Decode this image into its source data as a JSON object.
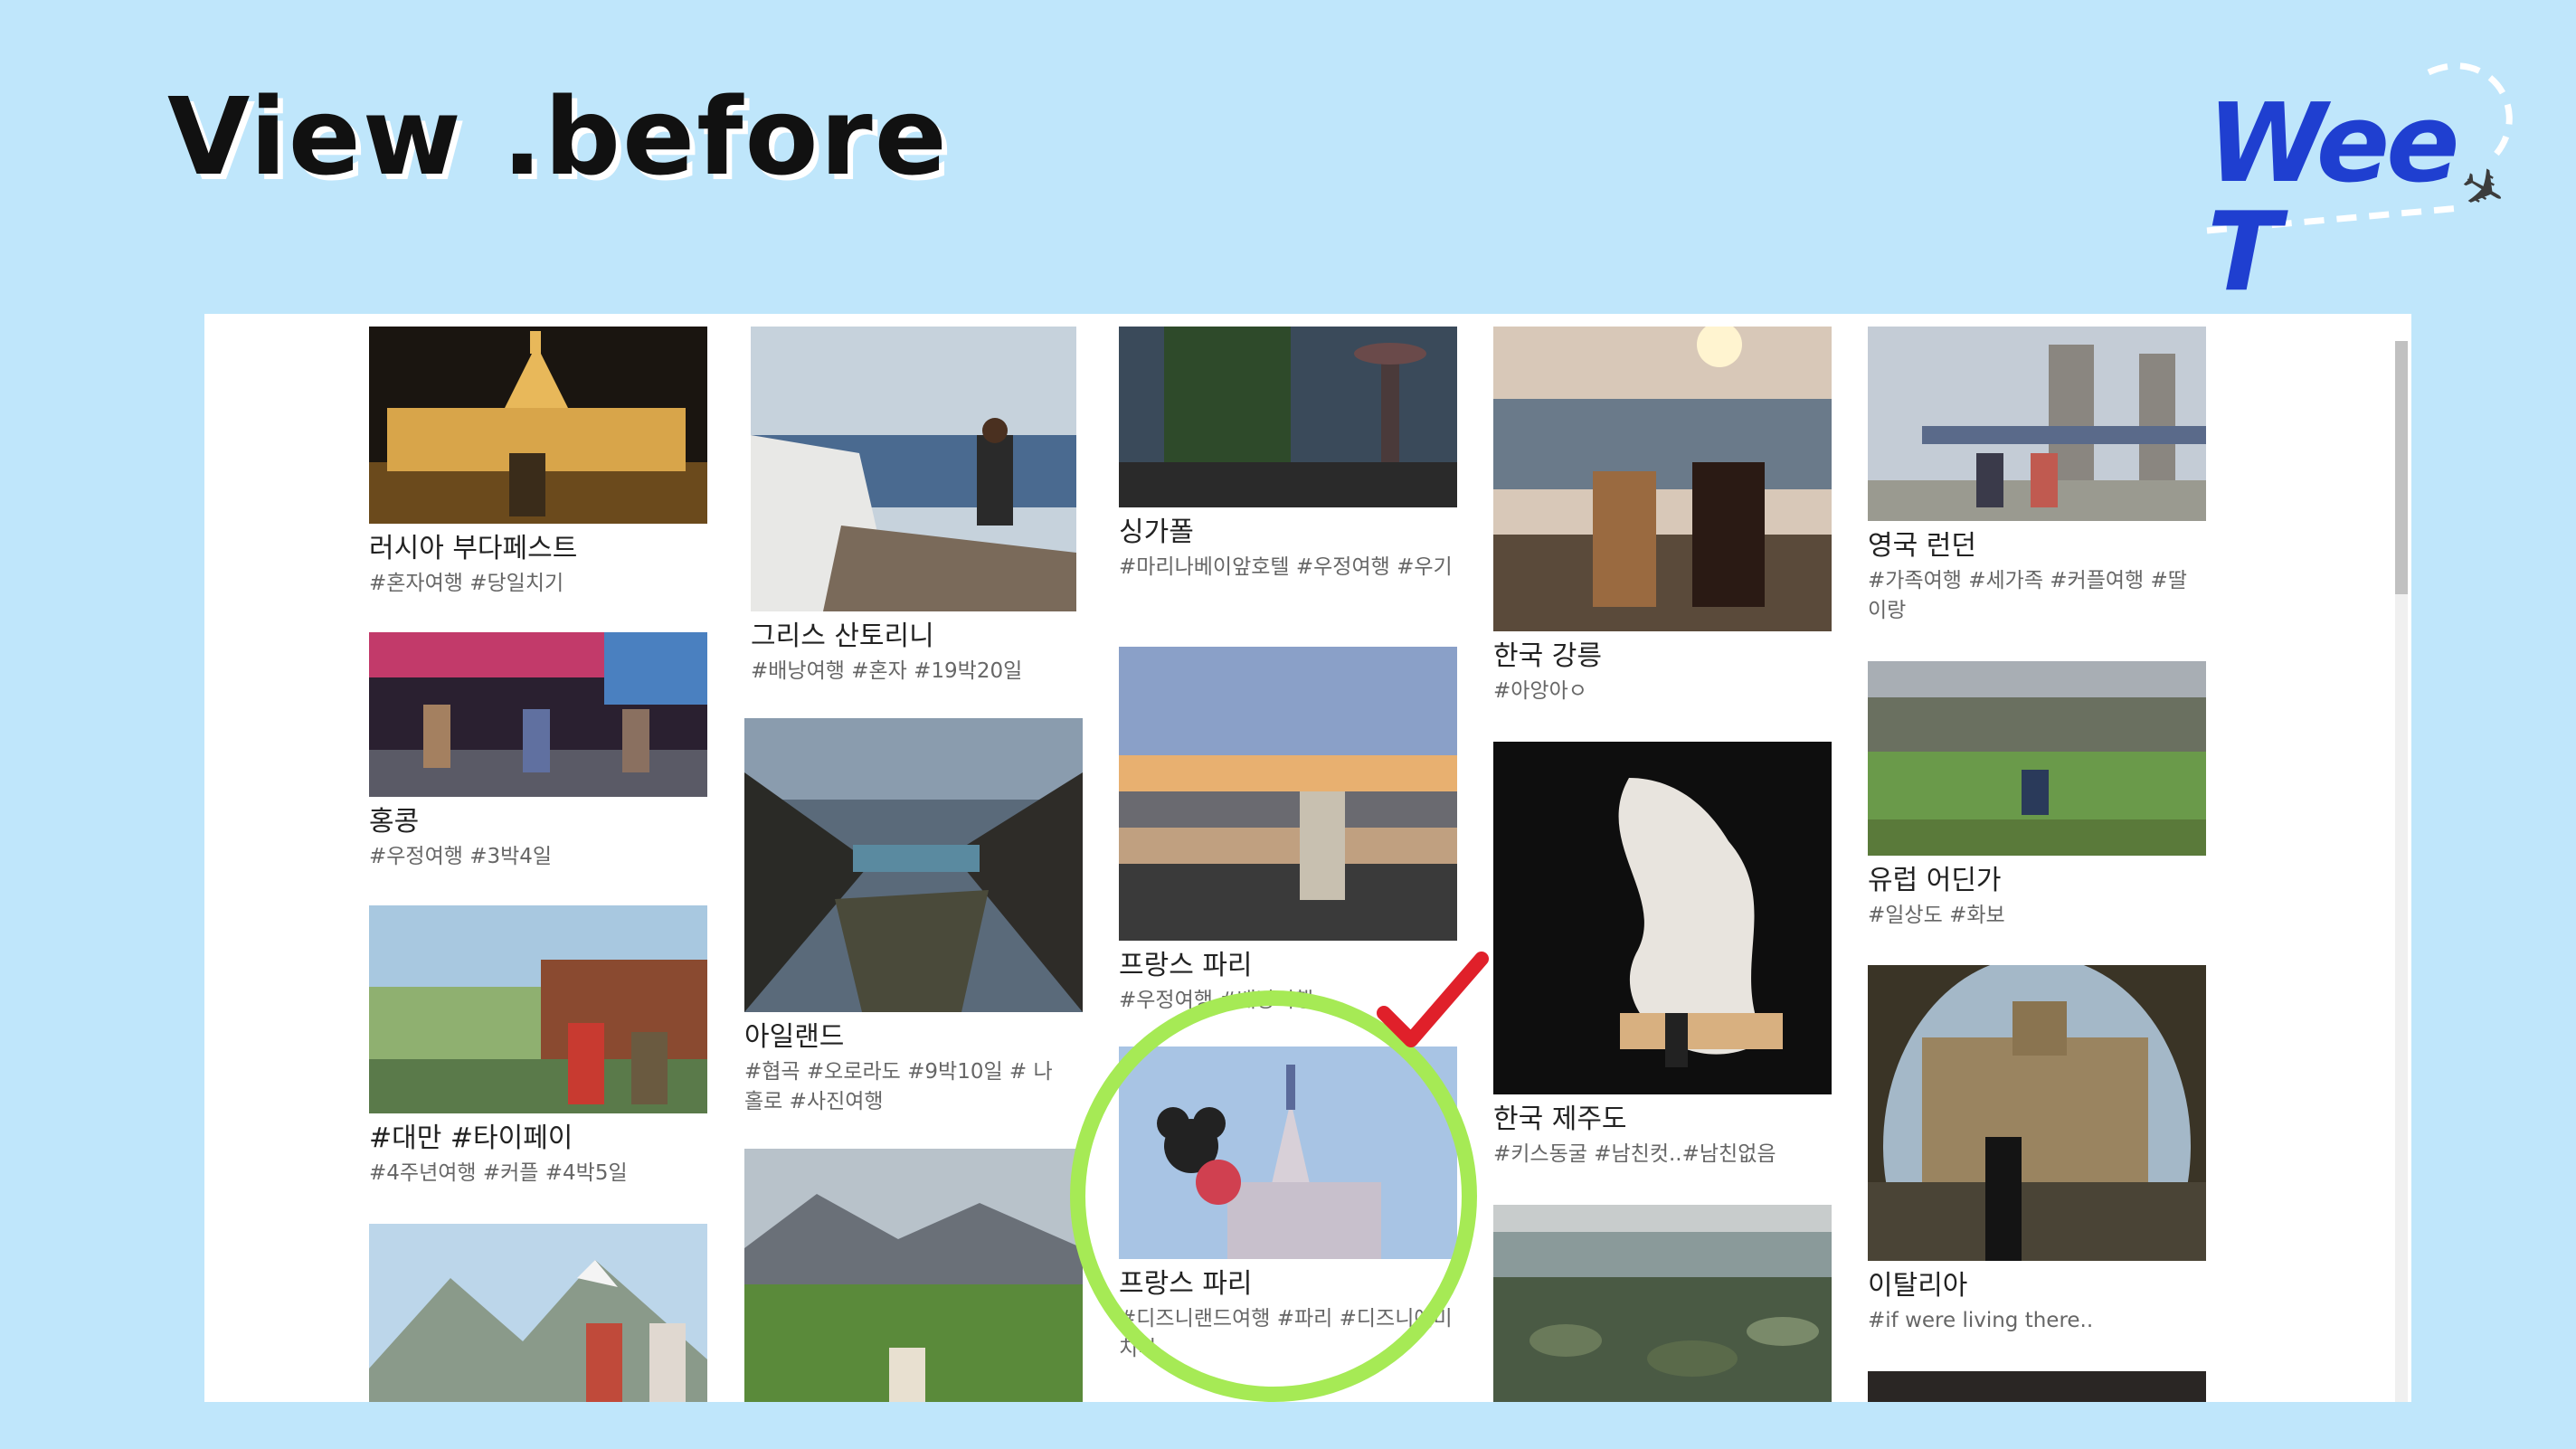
{
  "slide": {
    "title": "View .before",
    "logo_text": "Wee T"
  },
  "cards": [
    {
      "title": "러시아 부다페스트",
      "tags": "#혼자여행 #당일치기"
    },
    {
      "title": "홍콩",
      "tags": "#우정여행 #3박4일"
    },
    {
      "title": "#대만 #타이페이",
      "tags": "#4주년여행 #커플 #4박5일"
    },
    {
      "title": "",
      "tags": ""
    },
    {
      "title": "그리스 산토리니",
      "tags": "#배낭여행 #혼자 #19박20일"
    },
    {
      "title": "아일랜드",
      "tags": "#협곡 #오로라도 #9박10일 # 나홀로 #사진여행"
    },
    {
      "title": "",
      "tags": ""
    },
    {
      "title": "싱가폴",
      "tags": "#마리나베이앞호텔 #우정여행 #우기"
    },
    {
      "title": "프랑스 파리",
      "tags": "#우정여행 #배낭여행"
    },
    {
      "title": "프랑스 파리",
      "tags": "#디즈니랜드여행 #파리 #디즈니에미치다"
    },
    {
      "title": "한국 강릉",
      "tags": "#아앙아ㅇ"
    },
    {
      "title": "한국 제주도",
      "tags": "#키스동굴 #남친컷..#남친없음"
    },
    {
      "title": "",
      "tags": ""
    },
    {
      "title": "영국 런던",
      "tags": "#가족여행 #세가족 #커플여행 #딸이랑"
    },
    {
      "title": "유럽 어딘가",
      "tags": "#일상도 #화보"
    },
    {
      "title": "이탈리아",
      "tags": "#if were living there.."
    },
    {
      "title": "",
      "tags": ""
    }
  ],
  "colors": {
    "background": "#bfe6fb",
    "highlight_circle": "#a6ea55",
    "check_mark": "#e0202a",
    "logo": "#1f3fd0"
  }
}
